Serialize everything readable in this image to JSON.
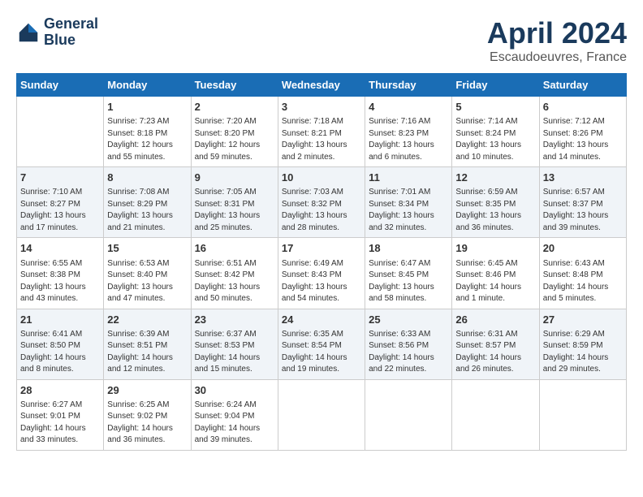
{
  "header": {
    "logo_line1": "General",
    "logo_line2": "Blue",
    "month": "April 2024",
    "location": "Escaudoeuvres, France"
  },
  "weekdays": [
    "Sunday",
    "Monday",
    "Tuesday",
    "Wednesday",
    "Thursday",
    "Friday",
    "Saturday"
  ],
  "weeks": [
    [
      {
        "day": "",
        "info": ""
      },
      {
        "day": "1",
        "info": "Sunrise: 7:23 AM\nSunset: 8:18 PM\nDaylight: 12 hours\nand 55 minutes."
      },
      {
        "day": "2",
        "info": "Sunrise: 7:20 AM\nSunset: 8:20 PM\nDaylight: 12 hours\nand 59 minutes."
      },
      {
        "day": "3",
        "info": "Sunrise: 7:18 AM\nSunset: 8:21 PM\nDaylight: 13 hours\nand 2 minutes."
      },
      {
        "day": "4",
        "info": "Sunrise: 7:16 AM\nSunset: 8:23 PM\nDaylight: 13 hours\nand 6 minutes."
      },
      {
        "day": "5",
        "info": "Sunrise: 7:14 AM\nSunset: 8:24 PM\nDaylight: 13 hours\nand 10 minutes."
      },
      {
        "day": "6",
        "info": "Sunrise: 7:12 AM\nSunset: 8:26 PM\nDaylight: 13 hours\nand 14 minutes."
      }
    ],
    [
      {
        "day": "7",
        "info": "Sunrise: 7:10 AM\nSunset: 8:27 PM\nDaylight: 13 hours\nand 17 minutes."
      },
      {
        "day": "8",
        "info": "Sunrise: 7:08 AM\nSunset: 8:29 PM\nDaylight: 13 hours\nand 21 minutes."
      },
      {
        "day": "9",
        "info": "Sunrise: 7:05 AM\nSunset: 8:31 PM\nDaylight: 13 hours\nand 25 minutes."
      },
      {
        "day": "10",
        "info": "Sunrise: 7:03 AM\nSunset: 8:32 PM\nDaylight: 13 hours\nand 28 minutes."
      },
      {
        "day": "11",
        "info": "Sunrise: 7:01 AM\nSunset: 8:34 PM\nDaylight: 13 hours\nand 32 minutes."
      },
      {
        "day": "12",
        "info": "Sunrise: 6:59 AM\nSunset: 8:35 PM\nDaylight: 13 hours\nand 36 minutes."
      },
      {
        "day": "13",
        "info": "Sunrise: 6:57 AM\nSunset: 8:37 PM\nDaylight: 13 hours\nand 39 minutes."
      }
    ],
    [
      {
        "day": "14",
        "info": "Sunrise: 6:55 AM\nSunset: 8:38 PM\nDaylight: 13 hours\nand 43 minutes."
      },
      {
        "day": "15",
        "info": "Sunrise: 6:53 AM\nSunset: 8:40 PM\nDaylight: 13 hours\nand 47 minutes."
      },
      {
        "day": "16",
        "info": "Sunrise: 6:51 AM\nSunset: 8:42 PM\nDaylight: 13 hours\nand 50 minutes."
      },
      {
        "day": "17",
        "info": "Sunrise: 6:49 AM\nSunset: 8:43 PM\nDaylight: 13 hours\nand 54 minutes."
      },
      {
        "day": "18",
        "info": "Sunrise: 6:47 AM\nSunset: 8:45 PM\nDaylight: 13 hours\nand 58 minutes."
      },
      {
        "day": "19",
        "info": "Sunrise: 6:45 AM\nSunset: 8:46 PM\nDaylight: 14 hours\nand 1 minute."
      },
      {
        "day": "20",
        "info": "Sunrise: 6:43 AM\nSunset: 8:48 PM\nDaylight: 14 hours\nand 5 minutes."
      }
    ],
    [
      {
        "day": "21",
        "info": "Sunrise: 6:41 AM\nSunset: 8:50 PM\nDaylight: 14 hours\nand 8 minutes."
      },
      {
        "day": "22",
        "info": "Sunrise: 6:39 AM\nSunset: 8:51 PM\nDaylight: 14 hours\nand 12 minutes."
      },
      {
        "day": "23",
        "info": "Sunrise: 6:37 AM\nSunset: 8:53 PM\nDaylight: 14 hours\nand 15 minutes."
      },
      {
        "day": "24",
        "info": "Sunrise: 6:35 AM\nSunset: 8:54 PM\nDaylight: 14 hours\nand 19 minutes."
      },
      {
        "day": "25",
        "info": "Sunrise: 6:33 AM\nSunset: 8:56 PM\nDaylight: 14 hours\nand 22 minutes."
      },
      {
        "day": "26",
        "info": "Sunrise: 6:31 AM\nSunset: 8:57 PM\nDaylight: 14 hours\nand 26 minutes."
      },
      {
        "day": "27",
        "info": "Sunrise: 6:29 AM\nSunset: 8:59 PM\nDaylight: 14 hours\nand 29 minutes."
      }
    ],
    [
      {
        "day": "28",
        "info": "Sunrise: 6:27 AM\nSunset: 9:01 PM\nDaylight: 14 hours\nand 33 minutes."
      },
      {
        "day": "29",
        "info": "Sunrise: 6:25 AM\nSunset: 9:02 PM\nDaylight: 14 hours\nand 36 minutes."
      },
      {
        "day": "30",
        "info": "Sunrise: 6:24 AM\nSunset: 9:04 PM\nDaylight: 14 hours\nand 39 minutes."
      },
      {
        "day": "",
        "info": ""
      },
      {
        "day": "",
        "info": ""
      },
      {
        "day": "",
        "info": ""
      },
      {
        "day": "",
        "info": ""
      }
    ]
  ]
}
